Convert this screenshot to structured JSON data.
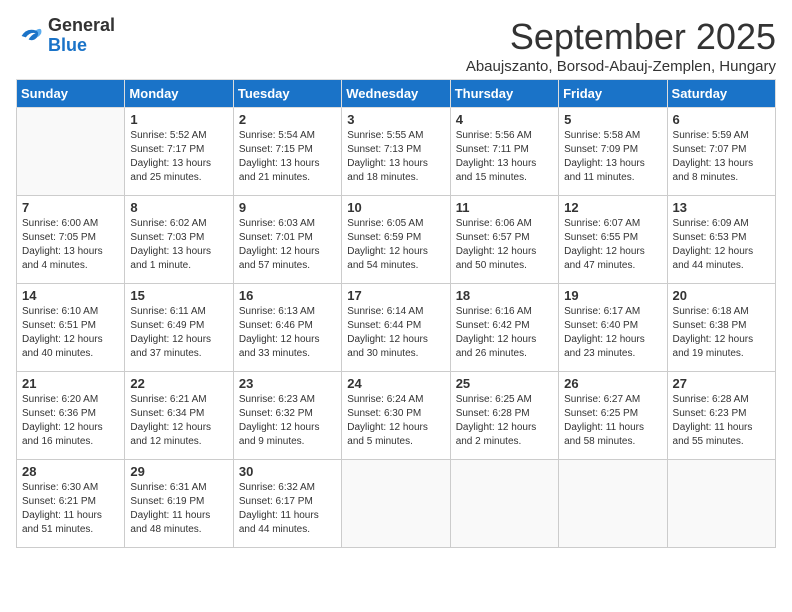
{
  "logo": {
    "line1": "General",
    "line2": "Blue"
  },
  "title": "September 2025",
  "subtitle": "Abaujszanto, Borsod-Abauj-Zemplen, Hungary",
  "weekdays": [
    "Sunday",
    "Monday",
    "Tuesday",
    "Wednesday",
    "Thursday",
    "Friday",
    "Saturday"
  ],
  "weeks": [
    [
      {
        "day": "",
        "info": ""
      },
      {
        "day": "1",
        "info": "Sunrise: 5:52 AM\nSunset: 7:17 PM\nDaylight: 13 hours\nand 25 minutes."
      },
      {
        "day": "2",
        "info": "Sunrise: 5:54 AM\nSunset: 7:15 PM\nDaylight: 13 hours\nand 21 minutes."
      },
      {
        "day": "3",
        "info": "Sunrise: 5:55 AM\nSunset: 7:13 PM\nDaylight: 13 hours\nand 18 minutes."
      },
      {
        "day": "4",
        "info": "Sunrise: 5:56 AM\nSunset: 7:11 PM\nDaylight: 13 hours\nand 15 minutes."
      },
      {
        "day": "5",
        "info": "Sunrise: 5:58 AM\nSunset: 7:09 PM\nDaylight: 13 hours\nand 11 minutes."
      },
      {
        "day": "6",
        "info": "Sunrise: 5:59 AM\nSunset: 7:07 PM\nDaylight: 13 hours\nand 8 minutes."
      }
    ],
    [
      {
        "day": "7",
        "info": "Sunrise: 6:00 AM\nSunset: 7:05 PM\nDaylight: 13 hours\nand 4 minutes."
      },
      {
        "day": "8",
        "info": "Sunrise: 6:02 AM\nSunset: 7:03 PM\nDaylight: 13 hours\nand 1 minute."
      },
      {
        "day": "9",
        "info": "Sunrise: 6:03 AM\nSunset: 7:01 PM\nDaylight: 12 hours\nand 57 minutes."
      },
      {
        "day": "10",
        "info": "Sunrise: 6:05 AM\nSunset: 6:59 PM\nDaylight: 12 hours\nand 54 minutes."
      },
      {
        "day": "11",
        "info": "Sunrise: 6:06 AM\nSunset: 6:57 PM\nDaylight: 12 hours\nand 50 minutes."
      },
      {
        "day": "12",
        "info": "Sunrise: 6:07 AM\nSunset: 6:55 PM\nDaylight: 12 hours\nand 47 minutes."
      },
      {
        "day": "13",
        "info": "Sunrise: 6:09 AM\nSunset: 6:53 PM\nDaylight: 12 hours\nand 44 minutes."
      }
    ],
    [
      {
        "day": "14",
        "info": "Sunrise: 6:10 AM\nSunset: 6:51 PM\nDaylight: 12 hours\nand 40 minutes."
      },
      {
        "day": "15",
        "info": "Sunrise: 6:11 AM\nSunset: 6:49 PM\nDaylight: 12 hours\nand 37 minutes."
      },
      {
        "day": "16",
        "info": "Sunrise: 6:13 AM\nSunset: 6:46 PM\nDaylight: 12 hours\nand 33 minutes."
      },
      {
        "day": "17",
        "info": "Sunrise: 6:14 AM\nSunset: 6:44 PM\nDaylight: 12 hours\nand 30 minutes."
      },
      {
        "day": "18",
        "info": "Sunrise: 6:16 AM\nSunset: 6:42 PM\nDaylight: 12 hours\nand 26 minutes."
      },
      {
        "day": "19",
        "info": "Sunrise: 6:17 AM\nSunset: 6:40 PM\nDaylight: 12 hours\nand 23 minutes."
      },
      {
        "day": "20",
        "info": "Sunrise: 6:18 AM\nSunset: 6:38 PM\nDaylight: 12 hours\nand 19 minutes."
      }
    ],
    [
      {
        "day": "21",
        "info": "Sunrise: 6:20 AM\nSunset: 6:36 PM\nDaylight: 12 hours\nand 16 minutes."
      },
      {
        "day": "22",
        "info": "Sunrise: 6:21 AM\nSunset: 6:34 PM\nDaylight: 12 hours\nand 12 minutes."
      },
      {
        "day": "23",
        "info": "Sunrise: 6:23 AM\nSunset: 6:32 PM\nDaylight: 12 hours\nand 9 minutes."
      },
      {
        "day": "24",
        "info": "Sunrise: 6:24 AM\nSunset: 6:30 PM\nDaylight: 12 hours\nand 5 minutes."
      },
      {
        "day": "25",
        "info": "Sunrise: 6:25 AM\nSunset: 6:28 PM\nDaylight: 12 hours\nand 2 minutes."
      },
      {
        "day": "26",
        "info": "Sunrise: 6:27 AM\nSunset: 6:25 PM\nDaylight: 11 hours\nand 58 minutes."
      },
      {
        "day": "27",
        "info": "Sunrise: 6:28 AM\nSunset: 6:23 PM\nDaylight: 11 hours\nand 55 minutes."
      }
    ],
    [
      {
        "day": "28",
        "info": "Sunrise: 6:30 AM\nSunset: 6:21 PM\nDaylight: 11 hours\nand 51 minutes."
      },
      {
        "day": "29",
        "info": "Sunrise: 6:31 AM\nSunset: 6:19 PM\nDaylight: 11 hours\nand 48 minutes."
      },
      {
        "day": "30",
        "info": "Sunrise: 6:32 AM\nSunset: 6:17 PM\nDaylight: 11 hours\nand 44 minutes."
      },
      {
        "day": "",
        "info": ""
      },
      {
        "day": "",
        "info": ""
      },
      {
        "day": "",
        "info": ""
      },
      {
        "day": "",
        "info": ""
      }
    ]
  ]
}
